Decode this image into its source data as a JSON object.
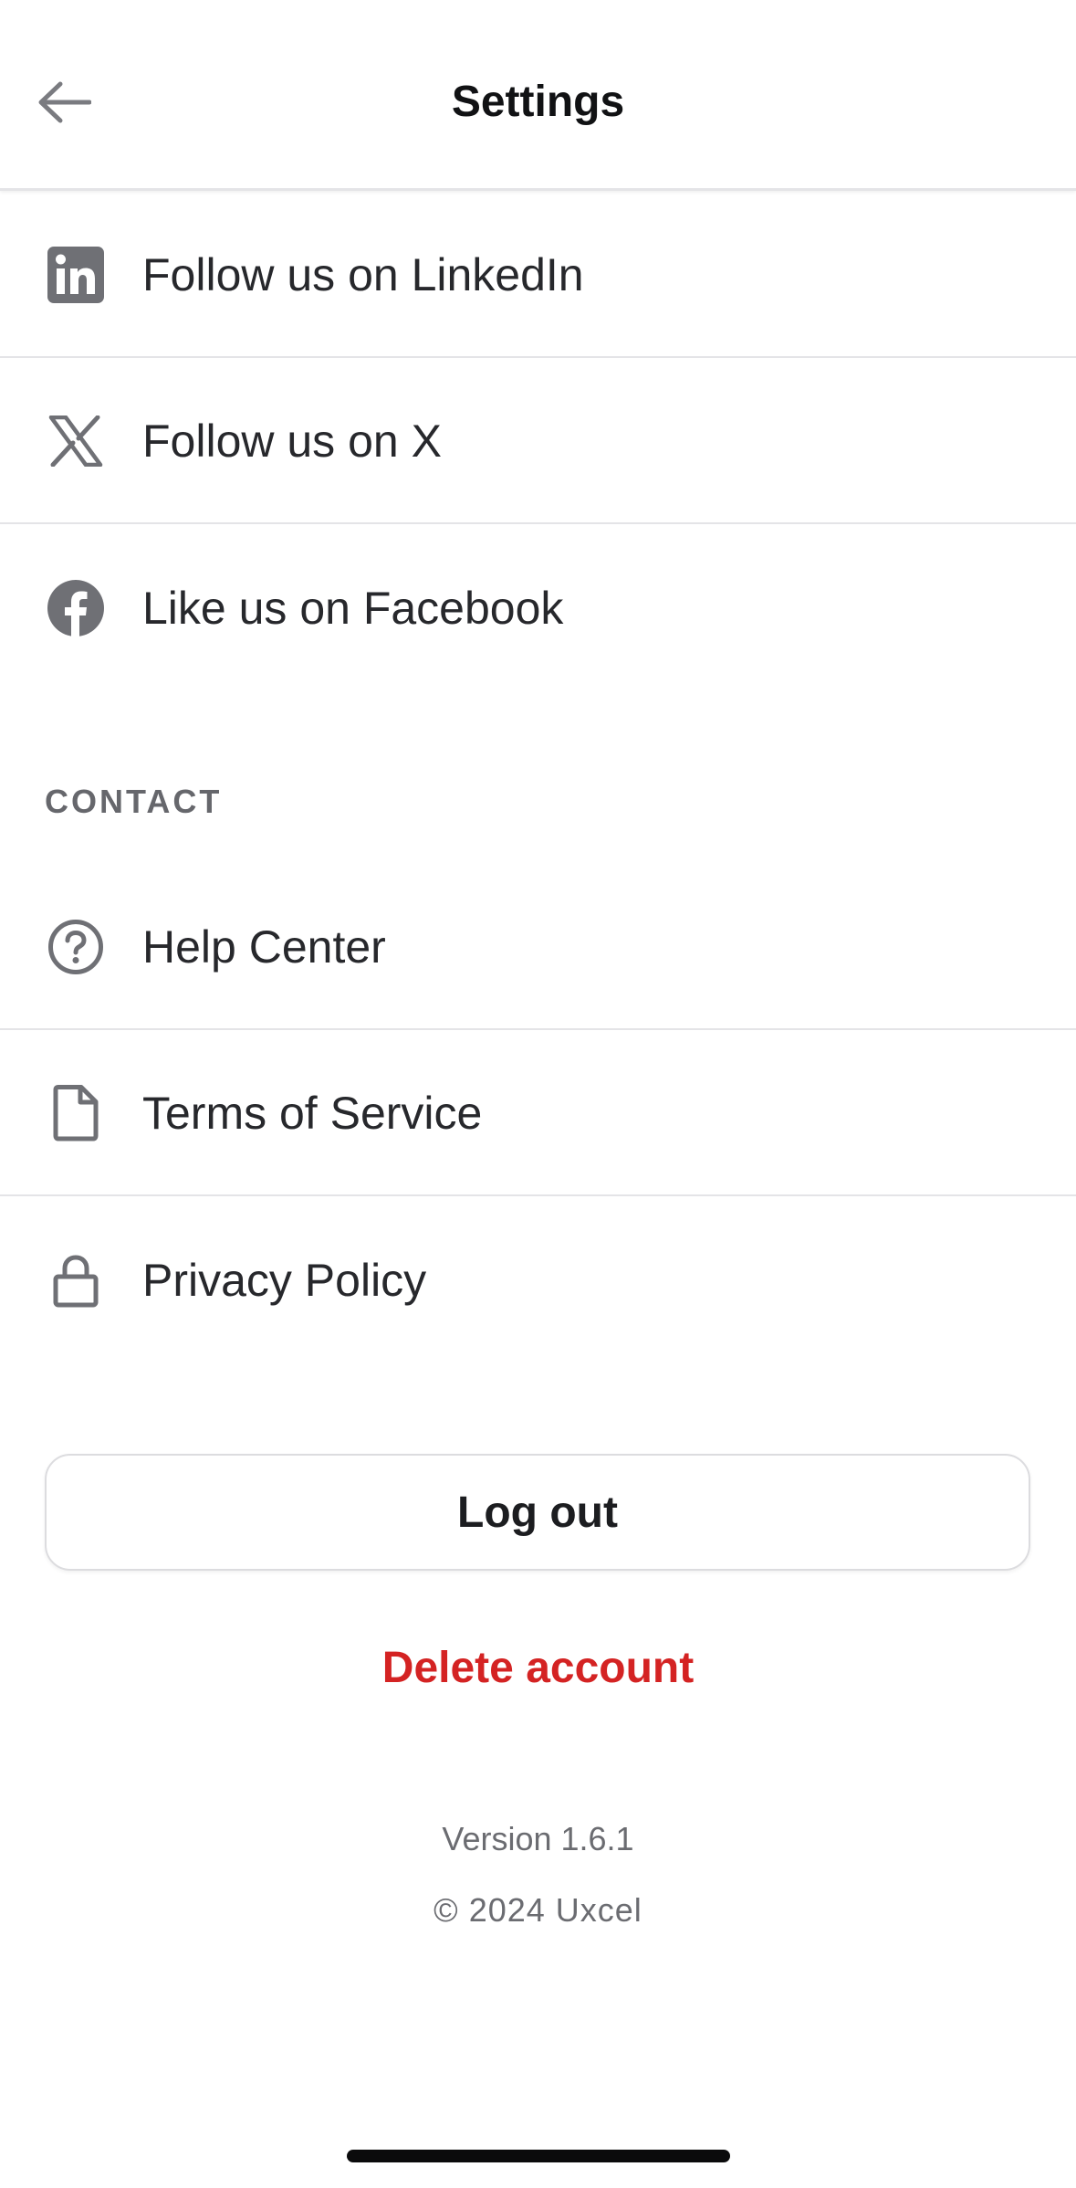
{
  "header": {
    "title": "Settings",
    "back_icon": "arrow-left-icon"
  },
  "social": {
    "items": [
      {
        "label": "Follow us on LinkedIn",
        "icon": "linkedin-icon"
      },
      {
        "label": "Follow us on X",
        "icon": "x-logo-icon"
      },
      {
        "label": "Like us on Facebook",
        "icon": "facebook-icon"
      }
    ]
  },
  "contact": {
    "heading": "CONTACT",
    "items": [
      {
        "label": "Help Center",
        "icon": "help-circle-icon"
      },
      {
        "label": "Terms of Service",
        "icon": "document-icon"
      },
      {
        "label": "Privacy Policy",
        "icon": "lock-icon"
      }
    ]
  },
  "actions": {
    "logout_label": "Log out",
    "delete_label": "Delete account"
  },
  "footer": {
    "version": "Version 1.6.1",
    "copyright": "© 2024 Uxcel"
  },
  "colors": {
    "danger": "#d42323",
    "icon": "#6f7075",
    "text": "#27282c",
    "divider": "#e4e4e7"
  }
}
